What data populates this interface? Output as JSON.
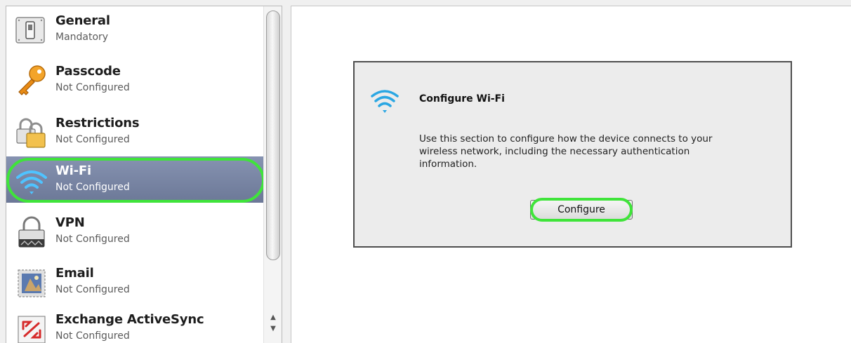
{
  "sidebar": {
    "items": [
      {
        "label": "General",
        "status": "Mandatory",
        "icon": "switch-icon"
      },
      {
        "label": "Passcode",
        "status": "Not Configured",
        "icon": "key-icon"
      },
      {
        "label": "Restrictions",
        "status": "Not Configured",
        "icon": "padlocks-icon"
      },
      {
        "label": "Wi-Fi",
        "status": "Not Configured",
        "icon": "wifi-icon",
        "selected": true
      },
      {
        "label": "VPN",
        "status": "Not Configured",
        "icon": "vpn-lock-icon"
      },
      {
        "label": "Email",
        "status": "Not Configured",
        "icon": "email-stamp-icon"
      },
      {
        "label": "Exchange ActiveSync",
        "status": "Not Configured",
        "icon": "exchange-icon"
      }
    ]
  },
  "dialog": {
    "title": "Configure Wi-Fi",
    "description": "Use this section to configure how the device connects to your wireless network, including the necessary authentication information.",
    "button_label": "Configure"
  },
  "colors": {
    "selection": "#7582a3",
    "highlight": "#3fe43a",
    "wifi": "#2ba7e3"
  }
}
